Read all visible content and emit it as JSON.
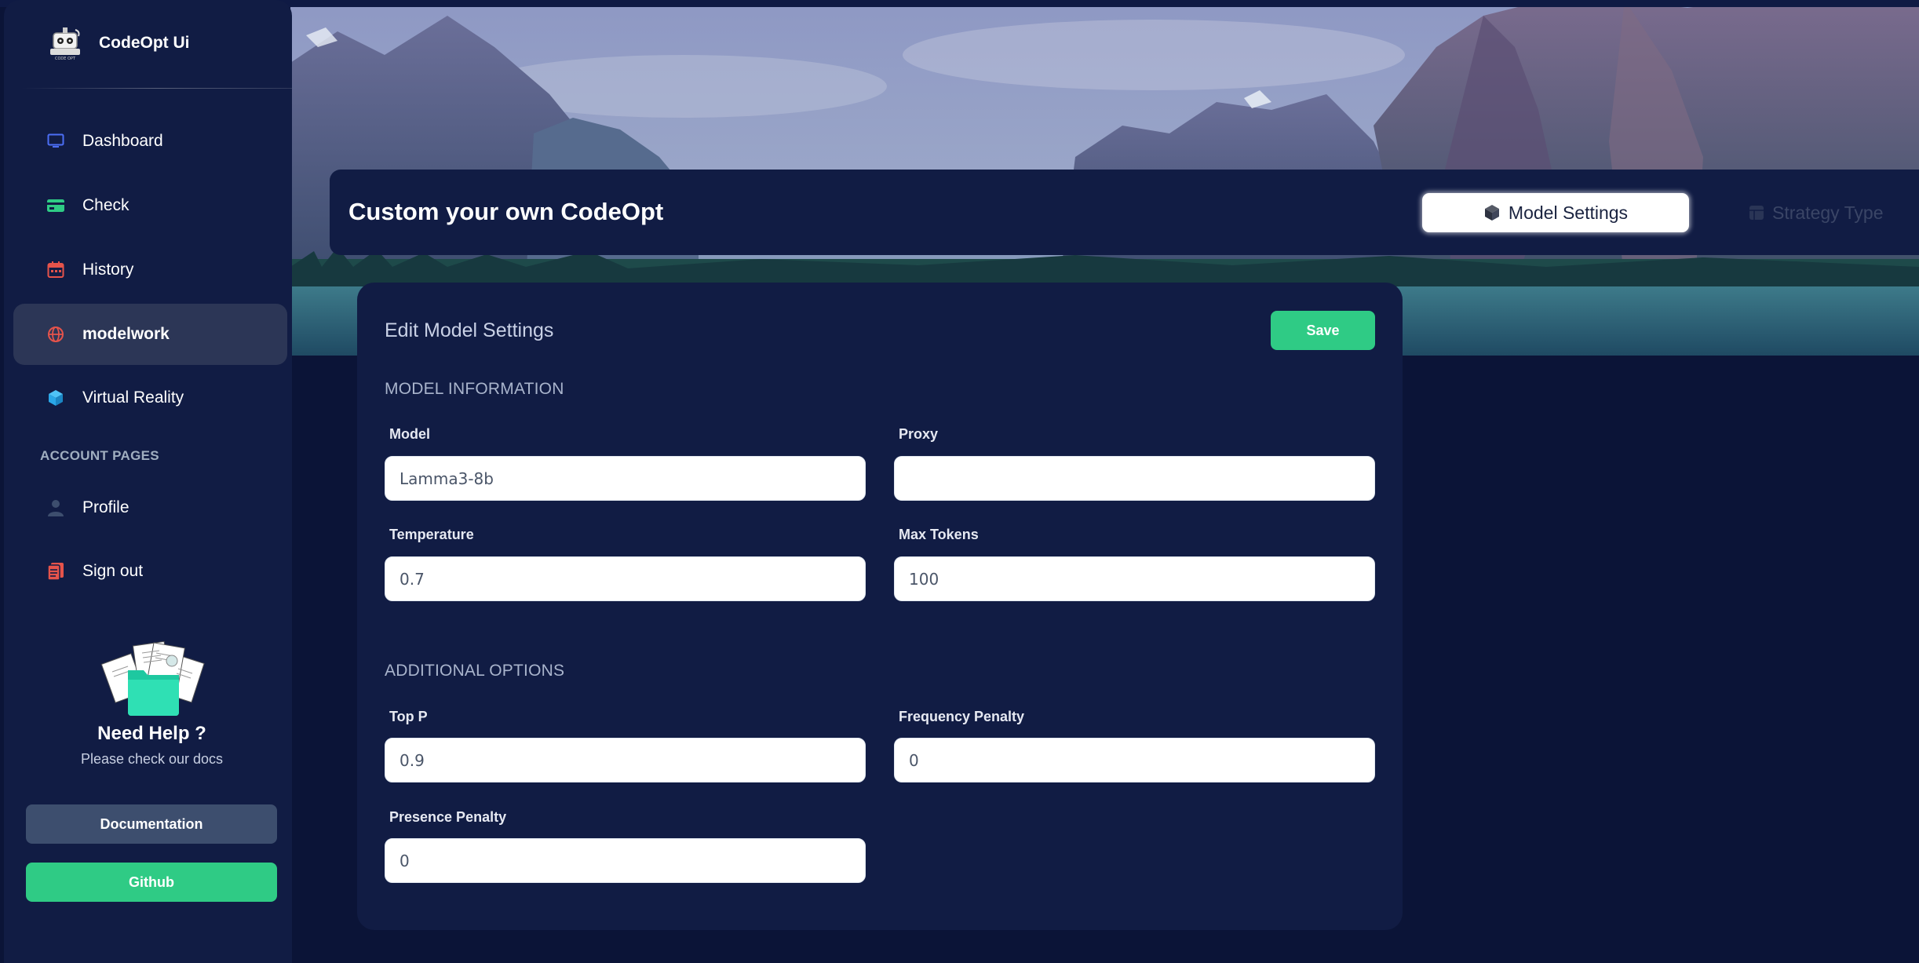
{
  "brand": {
    "name": "CodeOpt Ui",
    "logo_text": "CODE OPT"
  },
  "sidebar": {
    "items": [
      {
        "label": "Dashboard",
        "icon": "monitor-icon",
        "color": "#4c6ef5"
      },
      {
        "label": "Check",
        "icon": "credit-card-icon",
        "color": "#2fcb85"
      },
      {
        "label": "History",
        "icon": "calendar-icon",
        "color": "#e5534b"
      },
      {
        "label": "modelwork",
        "icon": "globe-icon",
        "color": "#e5534b",
        "active": true
      },
      {
        "label": "Virtual Reality",
        "icon": "box-icon",
        "color": "#2aa7e8"
      }
    ],
    "account_title": "ACCOUNT PAGES",
    "account_items": [
      {
        "label": "Profile",
        "icon": "user-icon",
        "color": "#3d4e6e"
      },
      {
        "label": "Sign out",
        "icon": "document-icon",
        "color": "#e5534b"
      }
    ],
    "help": {
      "title": "Need Help ?",
      "subtitle": "Please check our docs",
      "documentation_label": "Documentation",
      "github_label": "Github"
    }
  },
  "header": {
    "title": "Custom your own CodeOpt",
    "tabs": [
      {
        "label": "Model Settings",
        "icon": "cube-icon",
        "active": true
      },
      {
        "label": "Strategy Type",
        "icon": "grid-icon",
        "active": false
      }
    ]
  },
  "card": {
    "title": "Edit Model Settings",
    "save_label": "Save",
    "model_info_title": "MODEL INFORMATION",
    "additional_title": "ADDITIONAL OPTIONS",
    "fields": {
      "model": {
        "label": "Model",
        "value": "Lamma3-8b"
      },
      "proxy": {
        "label": "Proxy",
        "value": ""
      },
      "temperature": {
        "label": "Temperature",
        "value": "0.7"
      },
      "max_tokens": {
        "label": "Max Tokens",
        "value": "100"
      },
      "top_p": {
        "label": "Top P",
        "value": "0.9"
      },
      "frequency_penalty": {
        "label": "Frequency Penalty",
        "value": "0"
      },
      "presence_penalty": {
        "label": "Presence Penalty",
        "value": "0"
      }
    }
  },
  "colors": {
    "background": "#0b1437",
    "panel": "#111c44",
    "accent_green": "#2fcb85",
    "active_nav": "#2c3656"
  }
}
